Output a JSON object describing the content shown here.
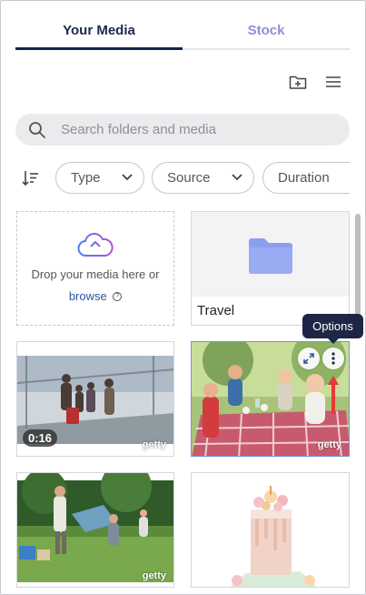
{
  "tabs": [
    {
      "label": "Your Media",
      "active": true
    },
    {
      "label": "Stock",
      "active": false
    }
  ],
  "toolbar": {
    "new_folder_icon": "folder-plus-icon",
    "view_menu_icon": "list-view-icon"
  },
  "search": {
    "placeholder": "Search folders and media",
    "value": ""
  },
  "filters": {
    "sort_icon": "sort-icon",
    "chips": [
      {
        "label": "Type"
      },
      {
        "label": "Source"
      },
      {
        "label": "Duration"
      }
    ]
  },
  "dropzone": {
    "text": "Drop your media here or",
    "link": "browse",
    "help_glyph": "?"
  },
  "folder": {
    "name": "Travel"
  },
  "media": [
    {
      "kind": "video",
      "duration": "0:16",
      "watermark": "getty",
      "subject": "family walking with luggage"
    },
    {
      "kind": "image",
      "watermark": "getty",
      "subject": "family picnic at table",
      "selected": true
    },
    {
      "kind": "image",
      "watermark": "getty",
      "subject": "family on lawn with blanket"
    },
    {
      "kind": "image",
      "subject": "layered cake with macarons"
    }
  ],
  "tooltip": {
    "text": "Options"
  },
  "colors": {
    "accent": "#14244b",
    "tab_inactive": "#8c8fd6",
    "folder": "#8c9ef0",
    "upload_gradient": [
      "#4f7cf0",
      "#b44fd6"
    ],
    "arrow": "#e53935"
  }
}
